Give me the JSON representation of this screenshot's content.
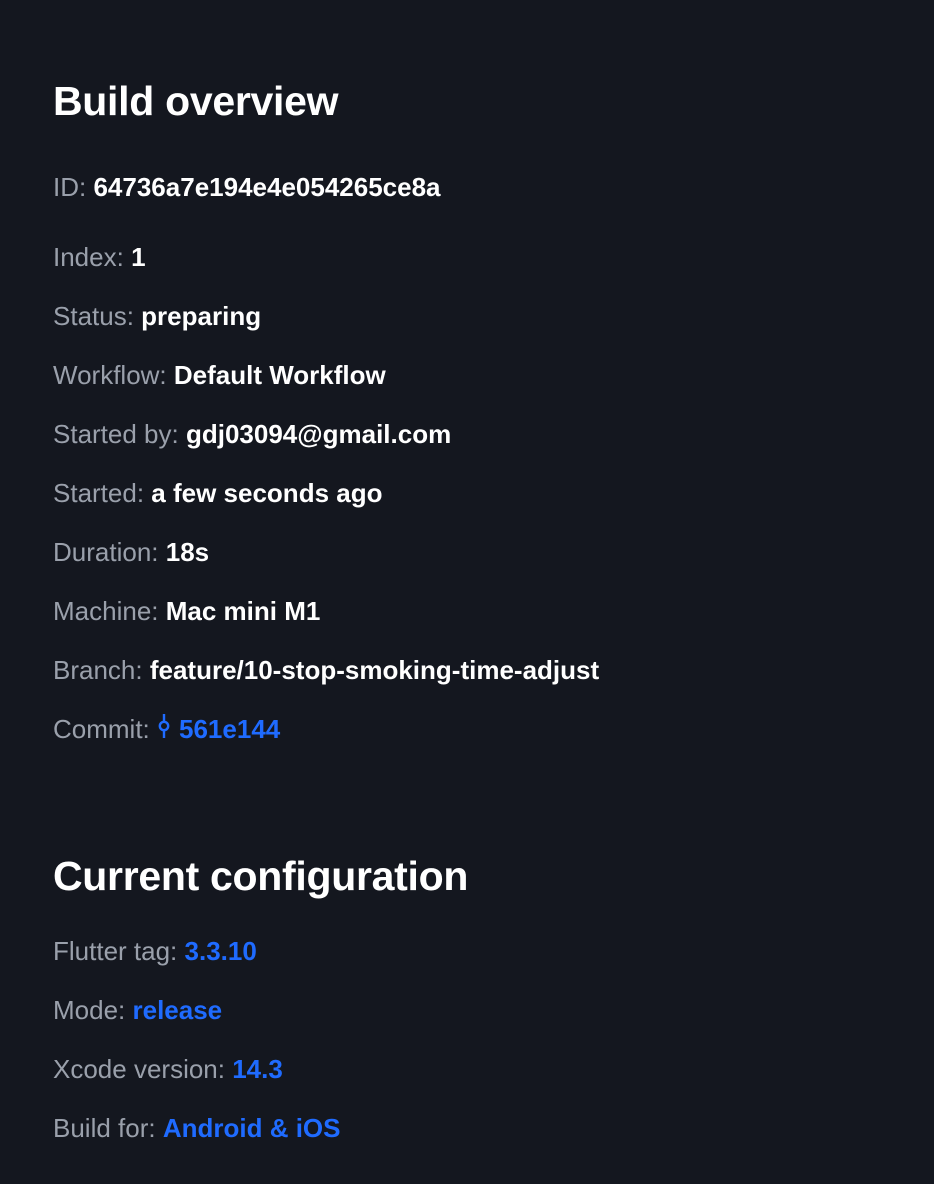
{
  "overview": {
    "title": "Build overview",
    "id": {
      "label": "ID:",
      "value": "64736a7e194e4e054265ce8a"
    },
    "index": {
      "label": "Index:",
      "value": "1"
    },
    "status": {
      "label": "Status:",
      "value": "preparing"
    },
    "workflow": {
      "label": "Workflow:",
      "value": "Default Workflow"
    },
    "started_by": {
      "label": "Started by:",
      "value": "gdj03094@gmail.com"
    },
    "started": {
      "label": "Started:",
      "value": "a few seconds ago"
    },
    "duration": {
      "label": "Duration:",
      "value": "18s"
    },
    "machine": {
      "label": "Machine:",
      "value": "Mac mini M1"
    },
    "branch": {
      "label": "Branch:",
      "value": "feature/10-stop-smoking-time-adjust"
    },
    "commit": {
      "label": "Commit:",
      "value": "561e144",
      "icon": "git-commit-icon"
    }
  },
  "configuration": {
    "title": "Current configuration",
    "flutter_tag": {
      "label": "Flutter tag:",
      "value": "3.3.10"
    },
    "mode": {
      "label": "Mode:",
      "value": "release"
    },
    "xcode_version": {
      "label": "Xcode version:",
      "value": "14.3"
    },
    "build_for": {
      "label": "Build for:",
      "value": "Android & iOS"
    }
  },
  "colors": {
    "background": "#14171f",
    "label": "#9aa0ab",
    "value": "#ffffff",
    "link": "#1f6bff"
  }
}
